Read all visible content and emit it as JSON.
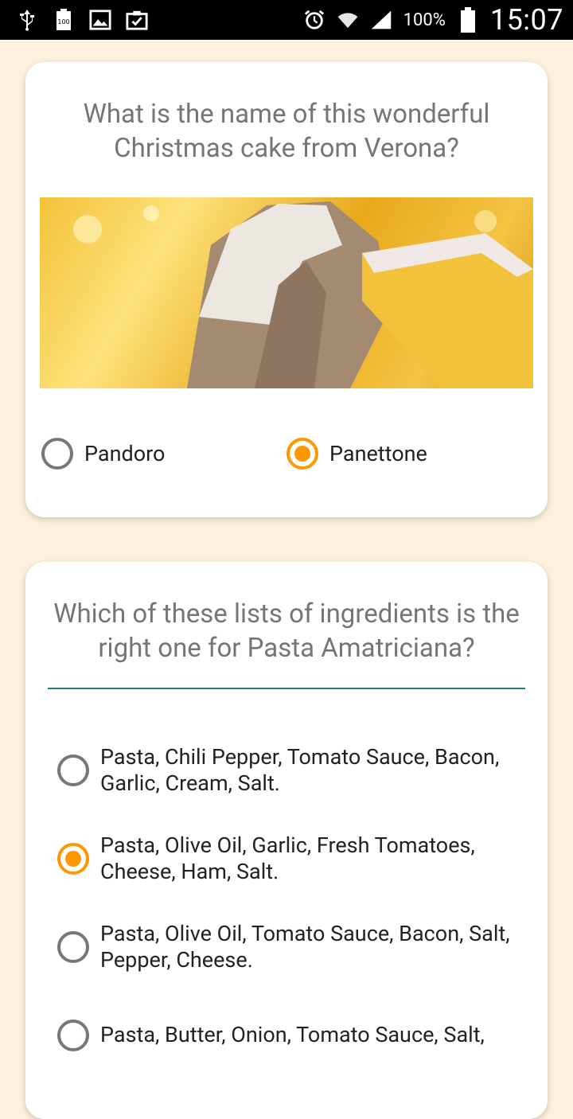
{
  "status_bar": {
    "battery_percent": "100%",
    "time": "15:07"
  },
  "question1": {
    "title": "What is the name of this wonderful Christmas cake from Verona?",
    "options": [
      {
        "label": "Pandoro",
        "selected": false
      },
      {
        "label": "Panettone",
        "selected": true
      }
    ]
  },
  "question2": {
    "title": "Which of these lists of ingredients is the right one for Pasta Amatriciana?",
    "options": [
      {
        "label": "Pasta, Chili Pepper, Tomato Sauce, Bacon, Garlic, Cream, Salt.",
        "selected": false
      },
      {
        "label": "Pasta, Olive Oil, Garlic, Fresh Tomatoes, Cheese, Ham, Salt.",
        "selected": true
      },
      {
        "label": "Pasta, Olive Oil, Tomato Sauce, Bacon, Salt, Pepper, Cheese.",
        "selected": false
      },
      {
        "label": "Pasta, Butter, Onion, Tomato Sauce, Salt,",
        "selected": false
      }
    ]
  },
  "colors": {
    "accent": "#ff9800",
    "background": "#fdf0dc",
    "divider": "#1f7c7c"
  }
}
